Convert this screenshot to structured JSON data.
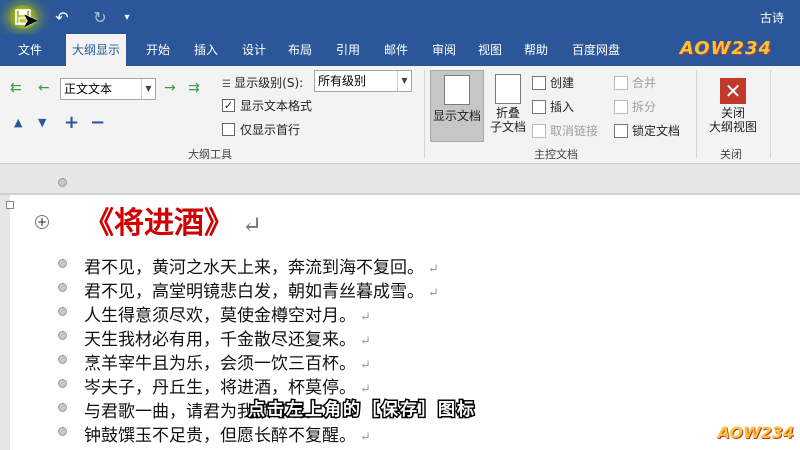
{
  "window": {
    "title": "古诗"
  },
  "qat": {
    "save": "save",
    "undo": "↶",
    "redo": "↻",
    "customize": "▾"
  },
  "tabs": [
    {
      "label": "文件"
    },
    {
      "label": "大纲显示"
    },
    {
      "label": "开始"
    },
    {
      "label": "插入"
    },
    {
      "label": "设计"
    },
    {
      "label": "布局"
    },
    {
      "label": "引用"
    },
    {
      "label": "邮件"
    },
    {
      "label": "审阅"
    },
    {
      "label": "视图"
    },
    {
      "label": "帮助"
    },
    {
      "label": "百度网盘"
    }
  ],
  "logo": "AOW234",
  "outline_tools": {
    "level_combo": "正文文本",
    "show_level_label": "显示级别(S):",
    "show_level_value": "所有级别",
    "show_text_format": "显示文本格式",
    "show_first_line": "仅显示首行",
    "group_label": "大纲工具"
  },
  "master_doc": {
    "show_doc": "显示文档",
    "collapse_line1": "折叠",
    "collapse_line2": "子文档",
    "create": "创建",
    "insert": "插入",
    "unlink": "取消链接",
    "merge": "合并",
    "split": "拆分",
    "lock": "锁定文档",
    "group_label": "主控文档"
  },
  "close_group": {
    "close_line1": "关闭",
    "close_line2": "大纲视图",
    "group_label": "关闭"
  },
  "document": {
    "title": "《将进酒》",
    "return_mark": "↵",
    "lines": [
      "君不见，黄河之水天上来，奔流到海不复回。",
      "君不见，高堂明镜悲白发，朝如青丝暮成雪。",
      "人生得意须尽欢，莫使金樽空对月。",
      "天生我材必有用，千金散尽还复来。",
      "烹羊宰牛且为乐，会须一饮三百杯。",
      "岑夫子，丹丘生，将进酒，杯莫停。",
      "与君歌一曲，请君为我倾耳听。",
      "钟鼓馔玉不足贵，但愿长醉不复醒。"
    ]
  },
  "subtitle": "点击左上角的［保存］图标",
  "watermark": "AOW234"
}
